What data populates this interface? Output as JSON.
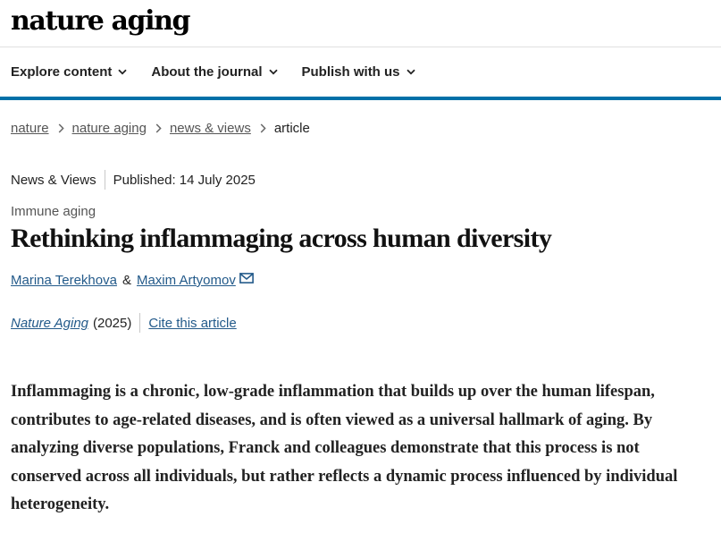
{
  "header": {
    "logo": "nature aging"
  },
  "nav": {
    "items": [
      {
        "label": "Explore content"
      },
      {
        "label": "About the journal"
      },
      {
        "label": "Publish with us"
      }
    ]
  },
  "breadcrumb": {
    "items": [
      "nature",
      "nature aging",
      "news & views"
    ],
    "current": "article"
  },
  "meta": {
    "type": "News & Views",
    "published": "Published: 14 July 2025"
  },
  "article": {
    "subject": "Immune aging",
    "title": "Rethinking inflammaging across human diversity",
    "authors": [
      "Marina Terekhova",
      "Maxim Artyomov"
    ],
    "author_separator": "&",
    "journal": "Nature Aging",
    "year": "(2025)",
    "cite": "Cite this article",
    "abstract": "Inflammaging is a chronic, low-grade inflammation that builds up over the human lifespan, contributes to age-related diseases, and is often viewed as a universal hallmark of aging. By analyzing diverse populations, Franck and colleagues demonstrate that this process is not conserved across all individuals, but rather reflects a dynamic process influenced by individual heterogeneity."
  },
  "colors": {
    "accent_rule": "#0070a8",
    "link": "#235a8a"
  },
  "icons": {
    "nav_dropdown": "chevron-down-icon",
    "breadcrumb_separator": "chevron-right-icon",
    "author_contact": "mail-icon"
  }
}
